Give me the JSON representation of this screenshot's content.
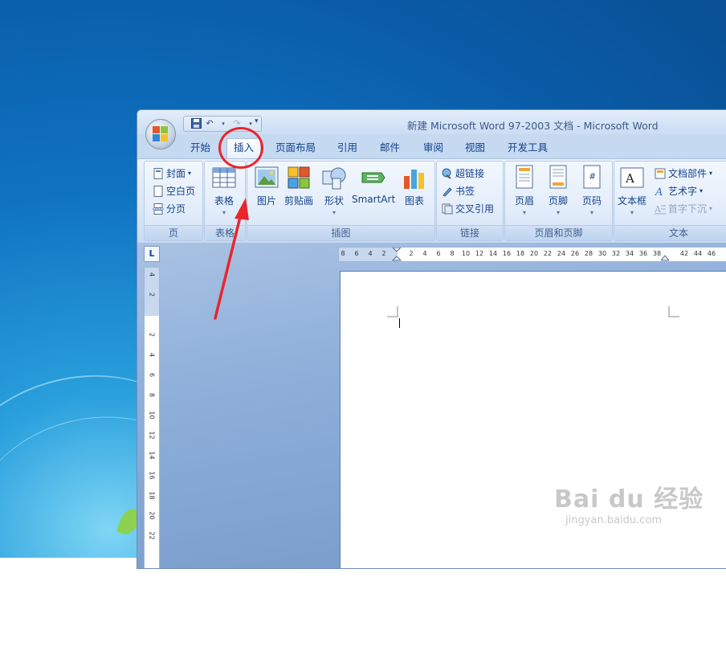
{
  "window": {
    "title": "新建 Microsoft Word 97-2003 文档 - Microsoft Word"
  },
  "quick_access": {
    "items": [
      {
        "icon": "save-icon"
      },
      {
        "icon": "undo-icon"
      },
      {
        "icon": "redo-icon"
      },
      {
        "icon": "customize-dropdown-icon"
      }
    ]
  },
  "tabs": [
    {
      "label": "开始",
      "active": false
    },
    {
      "label": "插入",
      "active": true
    },
    {
      "label": "页面布局",
      "active": false
    },
    {
      "label": "引用",
      "active": false
    },
    {
      "label": "邮件",
      "active": false
    },
    {
      "label": "审阅",
      "active": false
    },
    {
      "label": "视图",
      "active": false
    },
    {
      "label": "开发工具",
      "active": false
    }
  ],
  "ribbon": {
    "pages": {
      "label": "页",
      "items": [
        "封面",
        "空白页",
        "分页"
      ]
    },
    "tables": {
      "label": "表格",
      "items": [
        "表格"
      ]
    },
    "illustrations": {
      "label": "插图",
      "items": [
        "图片",
        "剪贴画",
        "形状",
        "SmartArt",
        "图表"
      ]
    },
    "links": {
      "label": "链接",
      "items": [
        "超链接",
        "书签",
        "交叉引用"
      ]
    },
    "header_footer": {
      "label": "页眉和页脚",
      "items": [
        "页眉",
        "页脚",
        "页码"
      ]
    },
    "text": {
      "label": "文本",
      "items": [
        "文本框",
        "文档部件",
        "艺术字",
        "首字下沉"
      ]
    }
  },
  "ruler": {
    "corner": "L",
    "h_ticks": [
      "8",
      "6",
      "4",
      "2",
      "",
      "2",
      "4",
      "6",
      "8",
      "10",
      "12",
      "14",
      "16",
      "18",
      "20",
      "22",
      "24",
      "26",
      "28",
      "30",
      "32",
      "34",
      "36",
      "38",
      "",
      "42",
      "44",
      "46"
    ],
    "v_ticks": [
      "4",
      "2",
      "",
      "2",
      "4",
      "6",
      "8",
      "10",
      "12",
      "14",
      "16",
      "18",
      "20",
      "22"
    ]
  },
  "watermark": {
    "main": "Bai du 经验",
    "sub": "jingyan.baidu.com"
  },
  "colors": {
    "annotation_red": "#e8262c",
    "ribbon_text": "#15428b"
  }
}
